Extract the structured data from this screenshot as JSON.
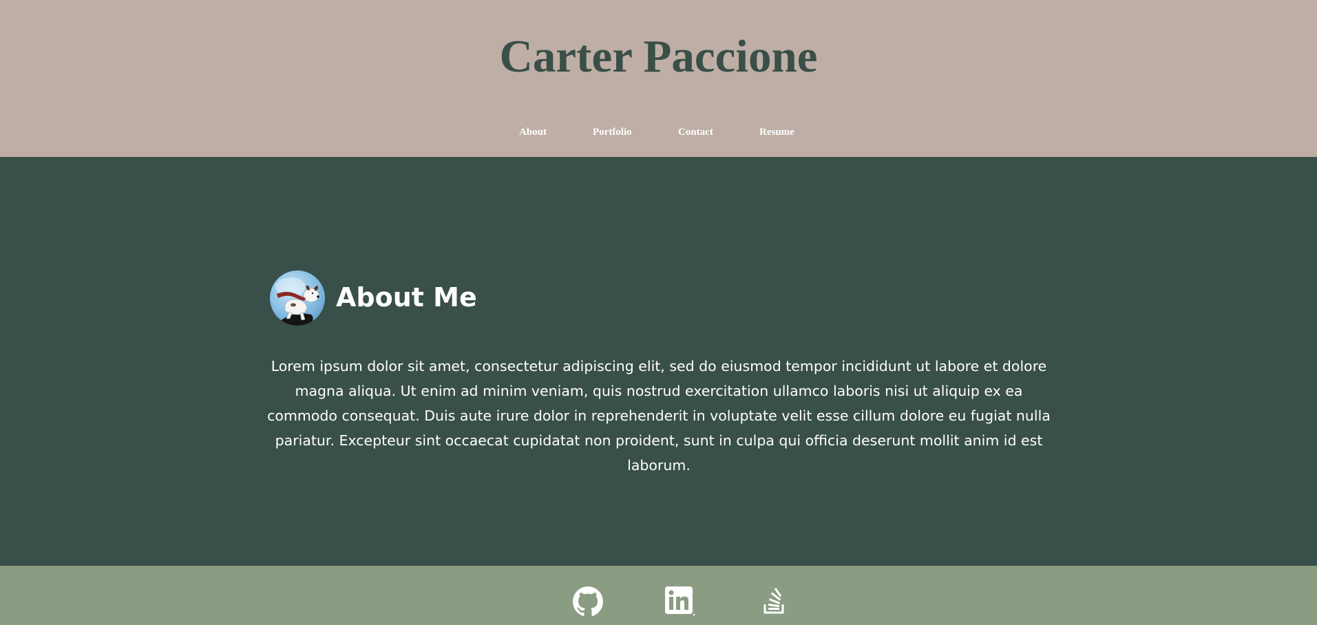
{
  "header": {
    "title": "Carter Paccione",
    "nav": [
      {
        "label": "About"
      },
      {
        "label": "Portfolio"
      },
      {
        "label": "Contact"
      },
      {
        "label": "Resume"
      }
    ]
  },
  "about": {
    "heading": "About Me",
    "avatar_icon": "avatar-dog-cartoon",
    "body": "Lorem ipsum dolor sit amet, consectetur adipiscing elit, sed do eiusmod tempor incididunt ut labore et dolore magna aliqua. Ut enim ad minim veniam, quis nostrud exercitation ullamco laboris nisi ut aliquip ex ea commodo consequat. Duis aute irure dolor in reprehenderit in voluptate velit esse cillum dolore eu fugiat nulla pariatur. Excepteur sint occaecat cupidatat non proident, sunt in culpa qui officia deserunt mollit anim id est laborum."
  },
  "footer": {
    "social": [
      {
        "icon": "github-icon"
      },
      {
        "icon": "linkedin-icon"
      },
      {
        "icon": "stackoverflow-icon"
      }
    ]
  },
  "colors": {
    "header_bg": "#beaea6",
    "main_bg": "#394f49",
    "footer_bg": "#8a9c82",
    "title_text": "#394f48",
    "light_text": "#ffffff"
  }
}
